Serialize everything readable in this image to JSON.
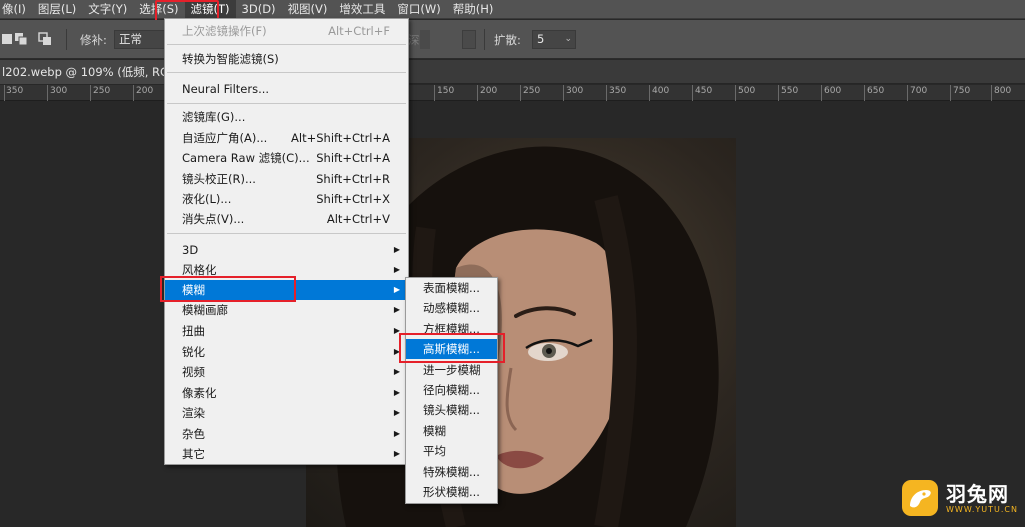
{
  "menubar": {
    "items": [
      {
        "label": "像(I)"
      },
      {
        "label": "图层(L)"
      },
      {
        "label": "文字(Y)"
      },
      {
        "label": "选择(S)"
      },
      {
        "label": "滤镜(T)"
      },
      {
        "label": "3D(D)"
      },
      {
        "label": "视图(V)"
      },
      {
        "label": "增效工具"
      },
      {
        "label": "窗口(W)"
      },
      {
        "label": "帮助(H)"
      }
    ]
  },
  "options": {
    "feather_label": "修补:",
    "mode_value": "正常",
    "faded_text": "深",
    "expand_label": "扩散:",
    "expand_value": "5"
  },
  "document": {
    "tab_title": "l202.webp @ 109% (低频, RGB/8"
  },
  "ruler": {
    "labels": [
      "350",
      "300",
      "250",
      "200",
      "150",
      "200",
      "250",
      "300",
      "350",
      "400",
      "450",
      "500",
      "550",
      "600",
      "650",
      "700",
      "750",
      "800"
    ]
  },
  "filter_menu": {
    "last_filter": {
      "label": "上次滤镜操作(F)",
      "shortcut": "Alt+Ctrl+F"
    },
    "smart_filter": {
      "label": "转换为智能滤镜(S)"
    },
    "neural": {
      "label": "Neural Filters..."
    },
    "gallery": {
      "label": "滤镜库(G)..."
    },
    "adaptive": {
      "label": "自适应广角(A)...",
      "shortcut": "Alt+Shift+Ctrl+A"
    },
    "camera_raw": {
      "label": "Camera Raw 滤镜(C)...",
      "shortcut": "Shift+Ctrl+A"
    },
    "lens_correction": {
      "label": "镜头校正(R)...",
      "shortcut": "Shift+Ctrl+R"
    },
    "liquify": {
      "label": "液化(L)...",
      "shortcut": "Shift+Ctrl+X"
    },
    "vanishing": {
      "label": "消失点(V)...",
      "shortcut": "Alt+Ctrl+V"
    },
    "submenus": [
      {
        "label": "3D"
      },
      {
        "label": "风格化"
      },
      {
        "label": "模糊"
      },
      {
        "label": "模糊画廊"
      },
      {
        "label": "扭曲"
      },
      {
        "label": "锐化"
      },
      {
        "label": "视频"
      },
      {
        "label": "像素化"
      },
      {
        "label": "渲染"
      },
      {
        "label": "杂色"
      },
      {
        "label": "其它"
      }
    ]
  },
  "blur_menu": {
    "items": [
      {
        "label": "表面模糊..."
      },
      {
        "label": "动感模糊..."
      },
      {
        "label": "方框模糊..."
      },
      {
        "label": "高斯模糊..."
      },
      {
        "label": "进一步模糊"
      },
      {
        "label": "径向模糊..."
      },
      {
        "label": "镜头模糊..."
      },
      {
        "label": "模糊"
      },
      {
        "label": "平均"
      },
      {
        "label": "特殊模糊..."
      },
      {
        "label": "形状模糊..."
      }
    ]
  },
  "watermark": {
    "title": "羽兔网",
    "url": "WWW.YUTU.CN"
  },
  "colors": {
    "highlight": "#0078d7",
    "annotation_red": "#e5202a",
    "brand_yellow": "#f5b521"
  }
}
